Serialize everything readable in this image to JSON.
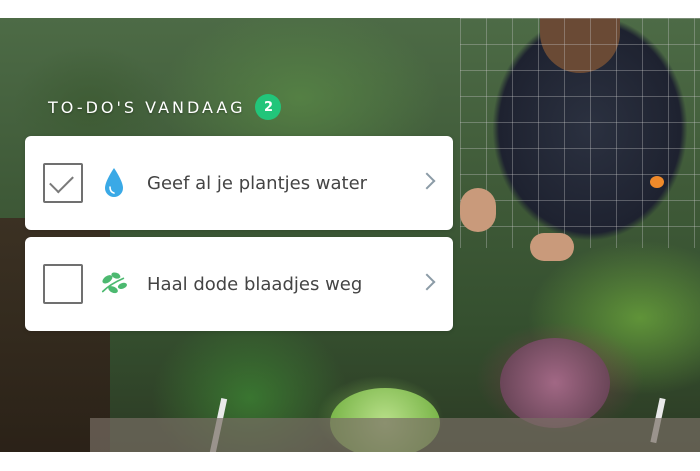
{
  "todo": {
    "title": "TO-DO'S VANDAAG",
    "count": "2",
    "accent_color": "#22c57a",
    "tasks": [
      {
        "label": "Geef al je plantjes water",
        "checked": true,
        "icon": "water-drop-icon",
        "icon_color": "#3aa9e6"
      },
      {
        "label": "Haal dode blaadjes weg",
        "checked": false,
        "icon": "leaves-icon",
        "icon_color": "#4cb970"
      }
    ]
  }
}
